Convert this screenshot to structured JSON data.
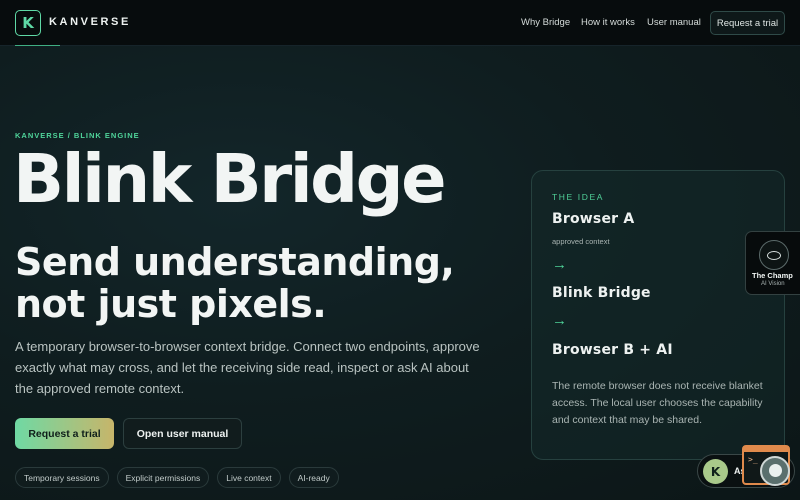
{
  "header": {
    "logo_letter": "K",
    "brand": "KANVERSE",
    "nav": {
      "why": "Why Bridge",
      "how": "How it works",
      "manual": "User manual"
    },
    "cta": "Request a trial"
  },
  "hero": {
    "eyebrow": "KANVERSE / BLINK ENGINE",
    "title": "Blink Bridge",
    "subtitle_line1": "Send understanding,",
    "subtitle_line2": "not just pixels.",
    "description": "A temporary browser-to-browser context bridge. Connect two endpoints, approve exactly what may cross, and let the receiving side read, inspect or ask AI about the approved remote context.",
    "primary_button": "Request a trial",
    "secondary_button": "Open user manual",
    "tags": [
      "Temporary sessions",
      "Explicit permissions",
      "Live context",
      "AI-ready"
    ]
  },
  "card": {
    "label": "THE IDEA",
    "step_a": "Browser A",
    "step_a_note": "approved context",
    "step_b": "Blink Bridge",
    "step_c": "Browser B + AI",
    "arrow": "→",
    "text": "The remote browser does not receive blanket access. The local user chooses the capability and context that may be shared."
  },
  "champ": {
    "name": "The Champ",
    "sub": "AI Vision"
  },
  "ask": {
    "avatar_letter": "K",
    "label": "Ask K"
  },
  "colors": {
    "accent": "#4fd49a",
    "background": "#0f1d1f",
    "header": "#070c0d",
    "primary_gradient_start": "#6fd9a4",
    "primary_gradient_end": "#c7b56a"
  }
}
